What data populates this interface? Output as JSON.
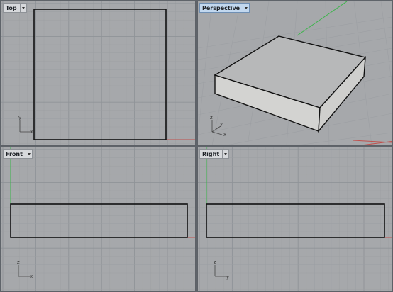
{
  "viewports": {
    "top": {
      "label": "Top",
      "axis_up": "y",
      "axis_right": "x"
    },
    "perspective": {
      "label": "Perspective",
      "axis_up": "z",
      "axis_a": "y",
      "axis_b": "x"
    },
    "front": {
      "label": "Front",
      "axis_up": "z",
      "axis_right": "x"
    },
    "right": {
      "label": "Right",
      "axis_up": "z",
      "axis_right": "y"
    }
  },
  "colors": {
    "viewport_bg": "#a6a8ab",
    "grid_minor": "#9b9ea2",
    "grid_major": "#8e9297",
    "axis_x": "#c0504d",
    "axis_y": "#3bb54a",
    "object_edge": "#111111",
    "box_top": "#b7b8b9",
    "box_front": "#d3d3d1",
    "box_side": "#cfcfcd"
  }
}
